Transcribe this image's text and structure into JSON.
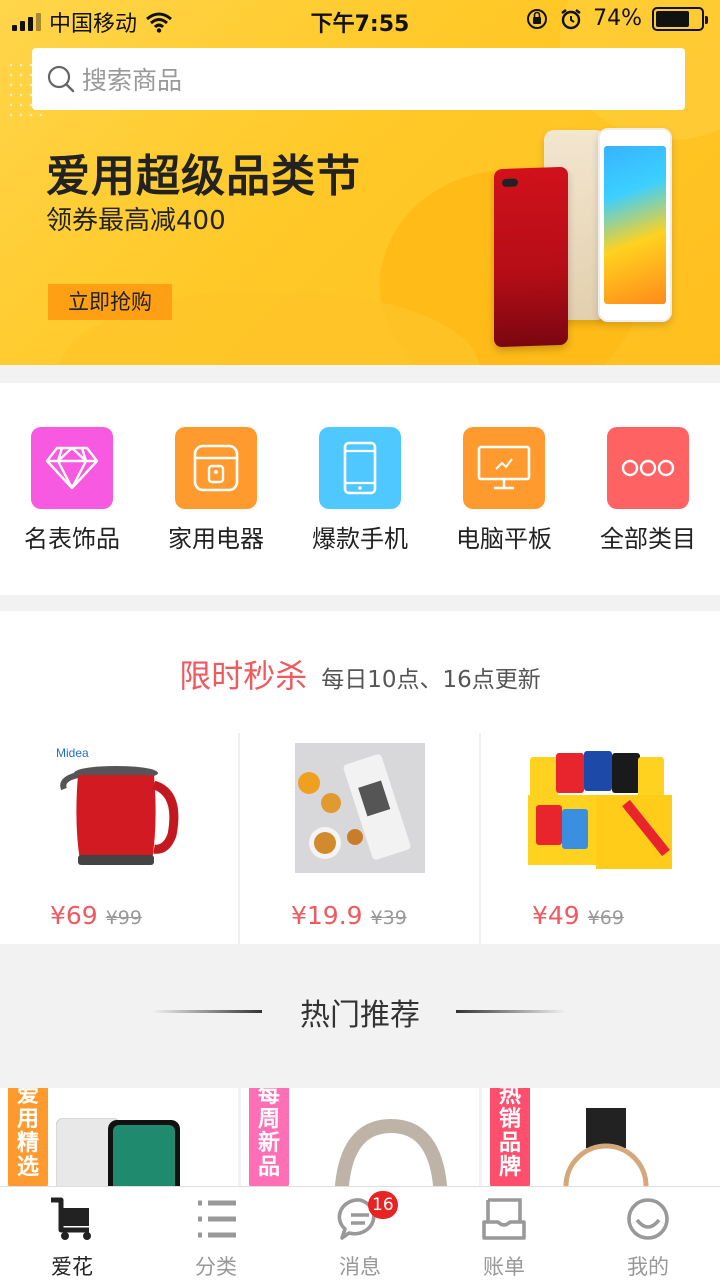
{
  "status_bar": {
    "carrier": "中国移动",
    "time": "下午7:55",
    "battery": "74%",
    "battery_level": 0.74
  },
  "search": {
    "placeholder": "搜索商品"
  },
  "banner": {
    "title": "爱用超级品类节",
    "subtitle": "领券最高减400",
    "button": "立即抢购"
  },
  "categories": [
    {
      "label": "名表饰品",
      "icon": "diamond-icon",
      "color": "#f759e0"
    },
    {
      "label": "家用电器",
      "icon": "rice-cooker-icon",
      "color": "#ff9a2e"
    },
    {
      "label": "爆款手机",
      "icon": "phone-icon",
      "color": "#4fc7ff"
    },
    {
      "label": "电脑平板",
      "icon": "monitor-icon",
      "color": "#ff9a2e"
    },
    {
      "label": "全部类目",
      "icon": "more-icon",
      "color": "#ff6262"
    }
  ],
  "flash_sale": {
    "title": "限时秒杀",
    "subtitle": "每日10点、16点更新",
    "items": [
      {
        "price": "¥69",
        "old_price": "¥99",
        "image": "kettle-image"
      },
      {
        "price": "¥19.9",
        "old_price": "¥39",
        "image": "snack-image"
      },
      {
        "price": "¥49",
        "old_price": "¥69",
        "image": "chips-box-image"
      }
    ]
  },
  "hot": {
    "title": "热门推荐",
    "cards": [
      {
        "tag": "爱用精选",
        "tag_color": "#ff9a2e"
      },
      {
        "tag": "每周新品",
        "tag_color": "#ff6fb5"
      },
      {
        "tag": "热销品牌",
        "tag_color": "#ff4f6e"
      }
    ]
  },
  "tabs": [
    {
      "label": "爱花",
      "icon": "cart-icon",
      "active": true
    },
    {
      "label": "分类",
      "icon": "list-icon",
      "active": false
    },
    {
      "label": "消息",
      "icon": "message-icon",
      "active": false,
      "badge": "16"
    },
    {
      "label": "账单",
      "icon": "bill-icon",
      "active": false
    },
    {
      "label": "我的",
      "icon": "profile-icon",
      "active": false
    }
  ]
}
